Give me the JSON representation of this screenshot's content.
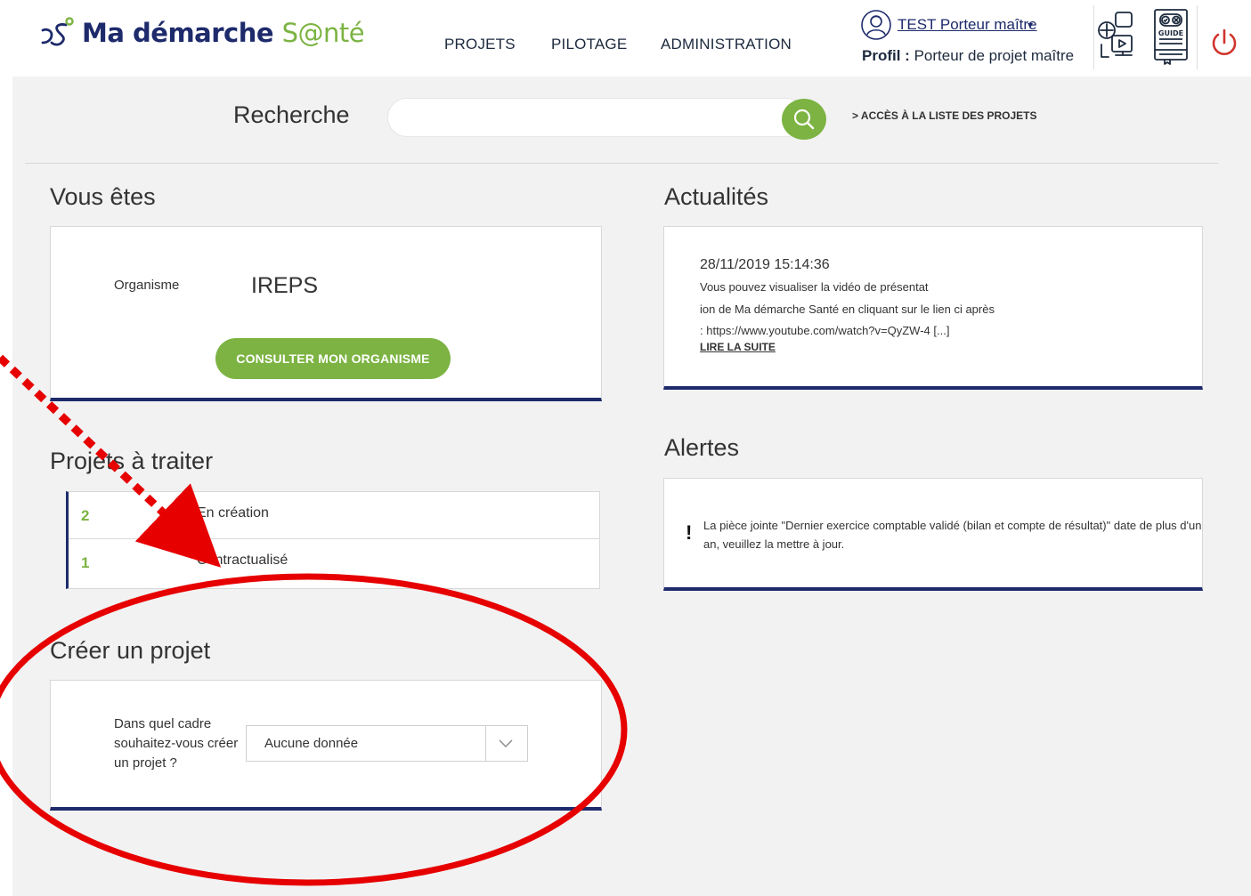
{
  "header": {
    "logo_main": "Ma démarche ",
    "logo_accent": "S@nté",
    "nav": [
      {
        "label": "PROJETS"
      },
      {
        "label": "PILOTAGE"
      },
      {
        "label": "ADMINISTRATION"
      }
    ],
    "user": {
      "name": "TEST Porteur maître",
      "caret": "▾",
      "profile_label": "Profil :",
      "profile_value": "Porteur de projet maître"
    },
    "guide_label": "GUIDE"
  },
  "search": {
    "label": "Recherche",
    "value": "",
    "projects_link": "> ACCÈS À LA LISTE DES PROJETS"
  },
  "vous_etes": {
    "title": "Vous êtes",
    "org_label": "Organisme",
    "org_value": "IREPS",
    "button": "CONSULTER MON ORGANISME"
  },
  "projets_a_traiter": {
    "title": "Projets à traiter",
    "rows": [
      {
        "count": "2",
        "status": "En création"
      },
      {
        "count": "1",
        "status": "Contractualisé"
      }
    ]
  },
  "creer_projet": {
    "title": "Créer un projet",
    "label": "Dans quel cadre souhaitez-vous créer un projet ?",
    "selected": "Aucune donnée"
  },
  "actualites": {
    "title": "Actualités",
    "date": "28/11/2019 15:14:36",
    "lines": [
      "Vous pouvez visualiser la vidéo de présentat",
      "ion de Ma démarche Santé en cliquant sur le lien ci après",
      ": https://www.youtube.com/watch?v=QyZW-4 [...]"
    ],
    "more": "LIRE LA SUITE"
  },
  "alertes": {
    "title": "Alertes",
    "icon": "!",
    "text": "La pièce jointe \"Dernier exercice comptable validé (bilan et compte de résultat)\" date de plus d'un an, veuillez la mettre à jour."
  },
  "colors": {
    "brand_navy": "#1d2a6b",
    "brand_green": "#7cb342",
    "power_red": "#d0342c",
    "annotation_red": "#e60000"
  }
}
